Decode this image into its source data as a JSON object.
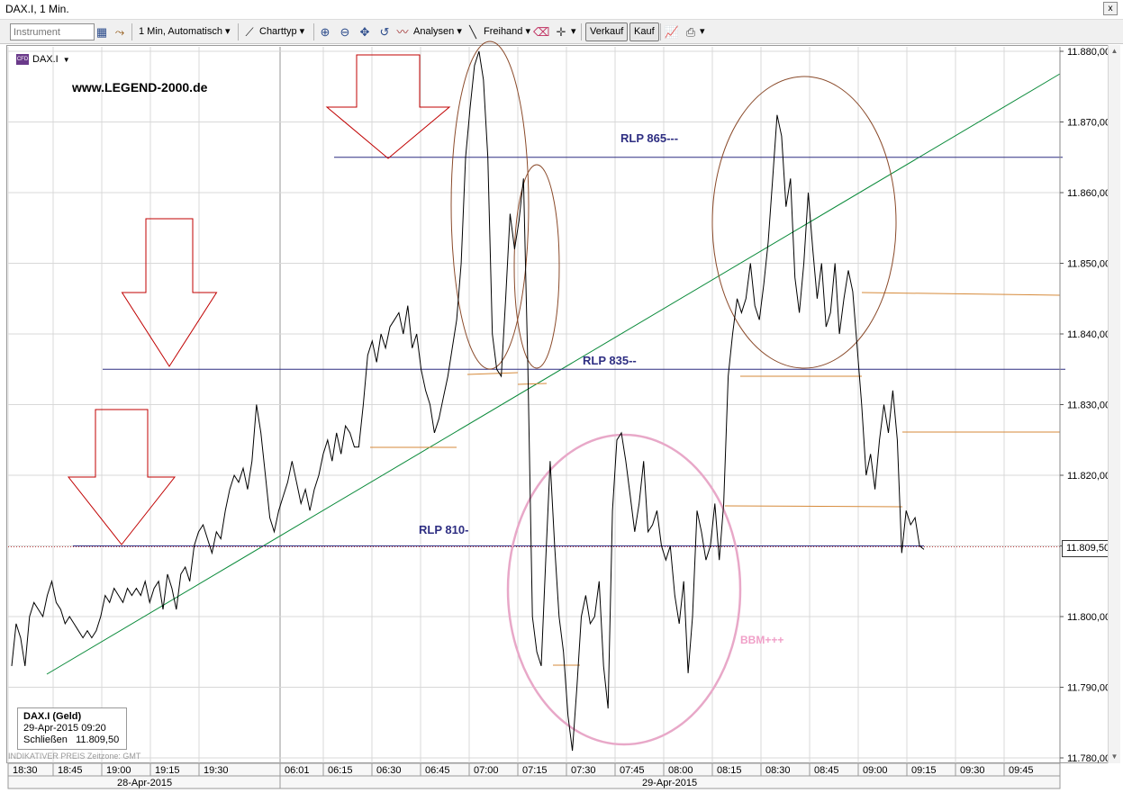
{
  "window": {
    "title": "DAX.I, 1 Min.",
    "close_label": "x"
  },
  "toolbar": {
    "instrument_placeholder": "Instrument",
    "interval_label": "1 Min,  Automatisch",
    "charttype_label": "Charttyp",
    "analysen_label": "Analysen",
    "freihand_label": "Freihand",
    "verkauf_label": "Verkauf",
    "kauf_label": "Kauf"
  },
  "instrument_tag": {
    "cfd_label": "CFD",
    "name": "DAX.I",
    "dropdown": "▼"
  },
  "website": "www.LEGEND-2000.de",
  "legend_box": {
    "title": "DAX.I (Geld)",
    "date": "29-Apr-2015 09:20",
    "close_label": "Schließen",
    "close_value": "11.809,50"
  },
  "indikativ_text": "INDIKATIVER PREIS   Zeitzone: GMT",
  "current_price": "11.809,50",
  "colors": {
    "price_line": "#000000",
    "level_line": "#2e2e82",
    "trend_line": "#0a8a3a",
    "support_lines": "#d68a3a",
    "arrow": "#c00000",
    "ellipse_brown": "#8a4a2a",
    "ellipse_pink": "#e8a8c8",
    "bbm_text": "#f0a0c8",
    "rlp_text": "#2e2e82",
    "grid": "#d8d8d8"
  },
  "chart_data": {
    "type": "line",
    "series": [
      {
        "values": [
          11793,
          11799,
          11797,
          11793,
          11800,
          11802,
          11801,
          11800,
          11803,
          11805,
          11802,
          11801,
          11799,
          11800,
          11799,
          11798,
          11797,
          11798,
          11797,
          11798,
          11800,
          11803,
          11802,
          11804,
          11803,
          11802,
          11804,
          11803,
          11804,
          11803,
          11805,
          11802,
          11804,
          11805,
          11801,
          11806,
          11804,
          11801,
          11806,
          11807,
          11805,
          11810,
          11812,
          11813,
          11811,
          11809,
          11812,
          11811,
          11815,
          11818,
          11820,
          11819,
          11821,
          11818,
          11822,
          11830,
          11826,
          11820,
          11814,
          11812,
          11815,
          11817,
          11819,
          11822,
          11819,
          11816,
          11818,
          11815,
          11818,
          11820,
          11823,
          11825,
          11822,
          11826,
          11823,
          11827,
          11826,
          11824,
          11824,
          11830,
          11837,
          11839,
          11836,
          11840,
          11838,
          11841,
          11842,
          11843,
          11840,
          11844,
          11838,
          11840,
          11835,
          11832,
          11830,
          11826,
          11828,
          11831,
          11834,
          11838,
          11842,
          11850,
          11865,
          11872,
          11878,
          11880,
          11876,
          11865,
          11840,
          11835,
          11834,
          11845,
          11857,
          11852,
          11856,
          11862,
          11835,
          11800,
          11795,
          11793,
          11808,
          11822,
          11810,
          11800,
          11795,
          11786,
          11781,
          11790,
          11800,
          11803,
          11799,
          11800,
          11805,
          11793,
          11787,
          11815,
          11825,
          11826,
          11822,
          11817,
          11812,
          11816,
          11822,
          11812,
          11813,
          11815,
          11810,
          11808,
          11810,
          11803,
          11799,
          11805,
          11792,
          11800,
          11815,
          11812,
          11808,
          11810,
          11816,
          11808,
          11816,
          11834,
          11840,
          11845,
          11843,
          11845,
          11850,
          11844,
          11842,
          11847,
          11853,
          11862,
          11871,
          11868,
          11858,
          11862,
          11848,
          11843,
          11850,
          11860,
          11852,
          11845,
          11850,
          11841,
          11843,
          11850,
          11840,
          11845,
          11849,
          11846,
          11838,
          11830,
          11820,
          11823,
          11818,
          11825,
          11830,
          11826,
          11832,
          11825,
          11809,
          11815,
          11813,
          11814,
          11810,
          11809.5
        ]
      }
    ],
    "x_tick_labels": [
      "18:30",
      "18:45",
      "19:00",
      "19:15",
      "19:30",
      "06:01",
      "06:15",
      "06:30",
      "06:45",
      "07:00",
      "07:15",
      "07:30",
      "07:45",
      "08:00",
      "08:15",
      "08:30",
      "08:45",
      "09:00",
      "09:15",
      "09:30",
      "09:45"
    ],
    "date_labels": [
      "28-Apr-2015",
      "29-Apr-2015"
    ],
    "y_tick_labels": [
      "11.880,00",
      "11.870,00",
      "11.860,00",
      "11.850,00",
      "11.840,00",
      "11.830,00",
      "11.820,00",
      "11.810,00",
      "11.800,00",
      "11.790,00",
      "11.780,00"
    ],
    "ylim": [
      11779,
      11882
    ],
    "levels": [
      {
        "label": "RLP 865---",
        "value": 11865
      },
      {
        "label": "RLP 835--",
        "value": 11835
      },
      {
        "label": "RLP 810-",
        "value": 11810
      }
    ],
    "annotations": [
      {
        "text": "BBM+++"
      }
    ],
    "grid": true
  }
}
